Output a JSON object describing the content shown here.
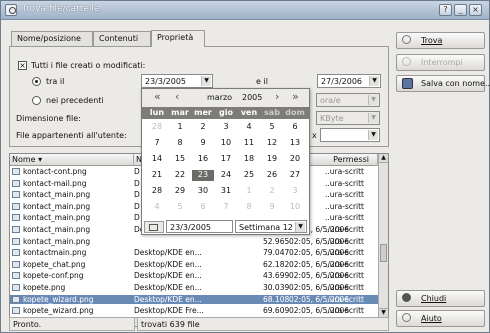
{
  "window": {
    "title": "Trova file/cartelle",
    "help_btn": "?",
    "min_btn": "_",
    "close_btn": "×"
  },
  "tabs": [
    "Nome/posizione",
    "Contenuti",
    "Proprietà"
  ],
  "props": {
    "all_files_label": "Tutti i file creati o modificati:",
    "all_files_checked": "×",
    "between_label": "tra il",
    "date_from": "23/3/2005",
    "and_label": "e il",
    "date_to": "27/3/2006",
    "previous_label": "nei precedenti",
    "unit_previous": "ora/e",
    "size_label": "Dimensione file:",
    "size_unit": "KByte",
    "owner_label": "File appartenenti all'utente:",
    "owner_x": "x"
  },
  "side_buttons": {
    "find": "Trova",
    "stop": "Interrompi",
    "save_as": "Salva con nome...",
    "close": "Chiudi",
    "help": "Aiuto"
  },
  "calendar": {
    "month": "marzo",
    "year": "2005",
    "weekdays": [
      "lun",
      "mar",
      "mer",
      "gio",
      "ven",
      "sab",
      "dom"
    ],
    "weeks": [
      [
        "28",
        "1",
        "2",
        "3",
        "4",
        "5",
        "6"
      ],
      [
        "7",
        "8",
        "9",
        "10",
        "11",
        "12",
        "13"
      ],
      [
        "14",
        "15",
        "16",
        "17",
        "18",
        "19",
        "20"
      ],
      [
        "21",
        "22",
        "23",
        "24",
        "25",
        "26",
        "27"
      ],
      [
        "28",
        "29",
        "30",
        "31",
        "1",
        "2",
        "3"
      ],
      [
        "4",
        "5",
        "6",
        "7",
        "8",
        "9",
        "10"
      ]
    ],
    "date_field": "23/3/2005",
    "week_select": "Settimana 12"
  },
  "list": {
    "columns": [
      "Nome",
      "N",
      "Permessi"
    ],
    "rows": [
      {
        "name": "kontact-cont.png",
        "folder": "D",
        "date": "2006",
        "perm": "..ura-scritt"
      },
      {
        "name": "kontact-mail.png",
        "folder": "D",
        "date": "2006",
        "perm": "..ura-scritt"
      },
      {
        "name": "kontact_main.png",
        "folder": "D",
        "date": "2006",
        "perm": "..ura-scritt"
      },
      {
        "name": "kontact_main.png",
        "folder": "D",
        "date": "2006",
        "perm": "..ura-scritt"
      },
      {
        "name": "kontact_main.png",
        "folder": "D",
        "date": "2006",
        "perm": "..ura-scritt"
      },
      {
        "name": "kontact_main.png",
        "folder": "Desktop/KDE Fre...",
        "size": "52.965",
        "date": "02:05, 6/5/2006",
        "perm": "..ura-scritt"
      },
      {
        "name": "kontact_main.png",
        "folder": "",
        "size": "52.965",
        "date": "02:05, 6/5/2006",
        "perm": "..ura-scritt"
      },
      {
        "name": "kontactmain.png",
        "folder": "Desktop/KDE en...",
        "size": "79.047",
        "date": "02:05, 6/5/2006",
        "perm": "..ura-scritt"
      },
      {
        "name": "kopete_chat.png",
        "folder": "Desktop/KDE en...",
        "size": "62.182",
        "date": "02:05, 6/5/2006",
        "perm": "..ura-scritt"
      },
      {
        "name": "kopete-conf.png",
        "folder": "Desktop/KDE en...",
        "size": "43.699",
        "date": "02:05, 6/5/2006",
        "perm": "..ura-scritt"
      },
      {
        "name": "kopete.png",
        "folder": "Desktop/KDE en...",
        "size": "30.039",
        "date": "02:05, 6/5/2006",
        "perm": "..ura-scritt"
      },
      {
        "name": "kopete_wizard.png",
        "folder": "Desktop/KDE en...",
        "size": "68.108",
        "date": "02:05, 6/5/2006",
        "perm": "..ura-scritt",
        "selected": true
      },
      {
        "name": "kopete_wizard.png",
        "folder": "Desktop/KDE Fre...",
        "size": "69.609",
        "date": "02:05, 6/5/2006",
        "perm": "..ura-scritt"
      }
    ]
  },
  "status": {
    "left": "Pronto.",
    "right": "trovati 639 file"
  }
}
